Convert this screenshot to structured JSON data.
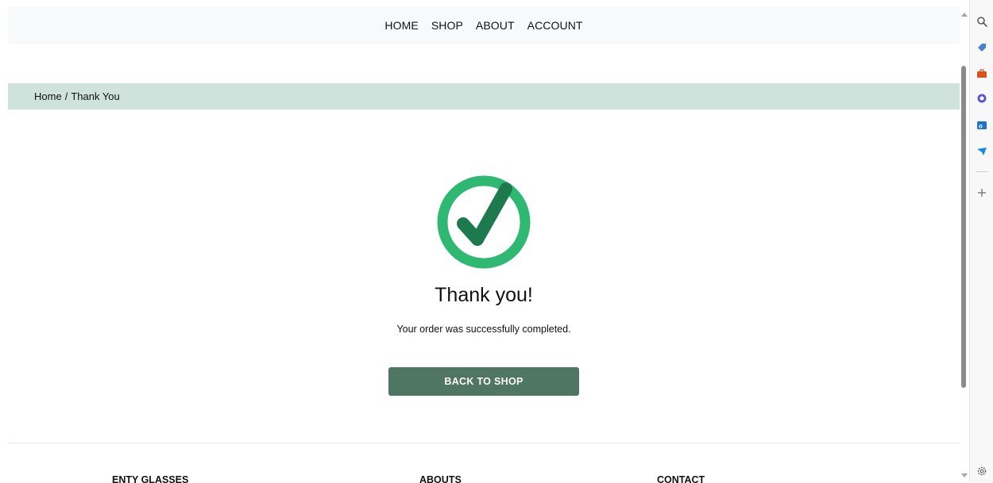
{
  "nav": {
    "items": [
      {
        "label": "HOME"
      },
      {
        "label": "SHOP"
      },
      {
        "label": "ABOUT"
      },
      {
        "label": "ACCOUNT"
      }
    ]
  },
  "breadcrumb": {
    "home": "Home",
    "separator": "/",
    "current": "Thank You"
  },
  "success": {
    "icon": "check-circle-icon",
    "title": "Thank you!",
    "message": "Your order was successfully completed.",
    "button_label": "BACK TO SHOP"
  },
  "footer": {
    "columns": [
      {
        "heading": "ENTY GLASSES"
      },
      {
        "heading": "ABOUTS"
      },
      {
        "heading": "CONTACT"
      }
    ]
  },
  "sidebar": {
    "icons": [
      "search-icon",
      "tag-icon",
      "briefcase-icon",
      "office-icon",
      "outlook-icon",
      "send-icon",
      "add-icon",
      "settings-icon"
    ]
  },
  "colors": {
    "breadcrumb_bg": "#cfe3dc",
    "button_bg": "#4f7563",
    "check_ring": "#2eb872",
    "check_mark": "#1d7a4e",
    "nav_bg": "#f8f9fa"
  }
}
